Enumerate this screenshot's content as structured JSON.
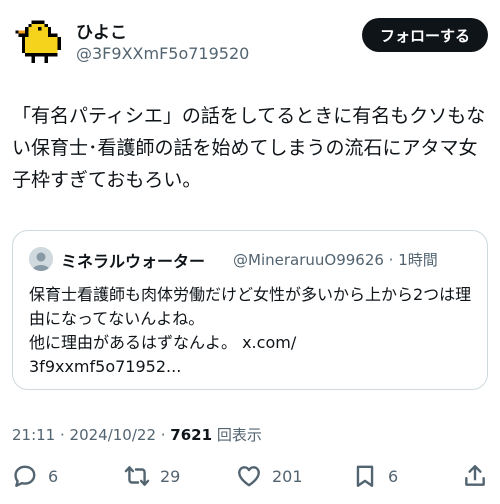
{
  "author": {
    "display_name": "ひよこ",
    "handle": "@3F9XXmF5o719520",
    "avatar_icon": "chick-pixel-icon"
  },
  "follow_label": "フォローする",
  "tweet_text": "「有名パティシエ」の話をしてるときに有名もクソもない保育士･看護師の話を始めてしまうの流石にアタマ女子枠すぎておもろい。",
  "quote": {
    "display_name": "ミネラルウォーター",
    "handle_time": "@MineraruuO99626 · 1時間",
    "text": "保育士看護師も肉体労働だけど女性が多いから上から2つは理由になってないんよね。\n他に理由があるはずなんよ。 x.com/\n3f9xxmf5o71952..."
  },
  "meta": {
    "time": "21:11 · 2024/10/22 · ",
    "views": "7621",
    "views_label": " 回表示"
  },
  "actions": {
    "replies": "6",
    "retweets": "29",
    "likes": "201",
    "bookmarks": "6"
  },
  "colors": {
    "text": "#0f1419",
    "secondary": "#536471",
    "border": "#cfd9de",
    "chick_yellow": "#f5d31c"
  }
}
